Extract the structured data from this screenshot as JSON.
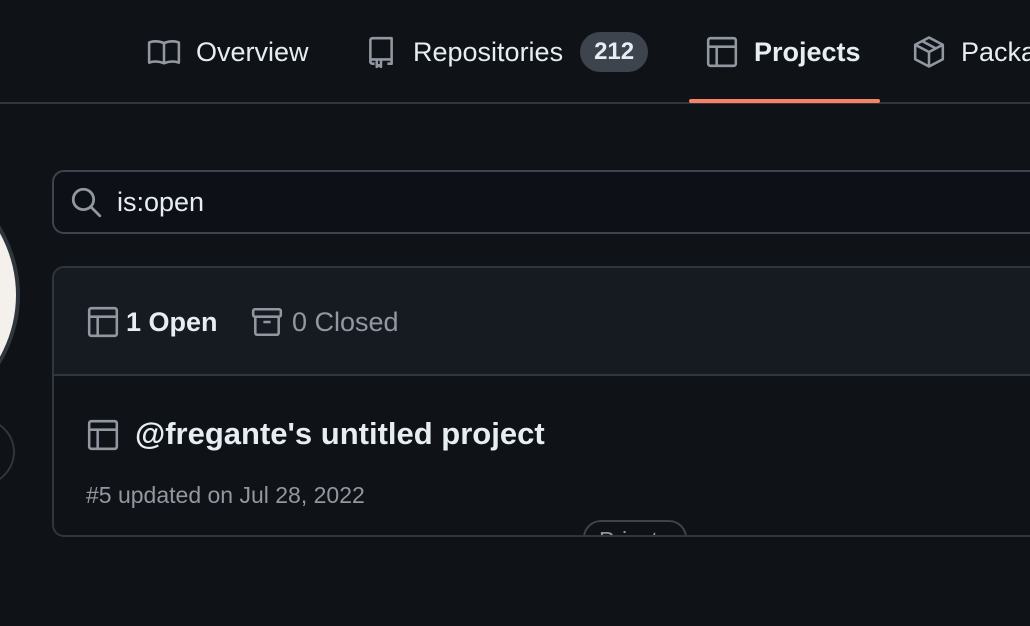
{
  "nav": {
    "tabs": [
      {
        "label": "Overview",
        "icon": "book-icon"
      },
      {
        "label": "Repositories",
        "icon": "repo-icon",
        "count": "212"
      },
      {
        "label": "Projects",
        "icon": "table-icon",
        "active": true
      },
      {
        "label": "Packages",
        "icon": "package-icon"
      }
    ]
  },
  "search": {
    "value": "is:open"
  },
  "filters": {
    "open_label": "1 Open",
    "closed_label": "0 Closed"
  },
  "projects": [
    {
      "title": "@fregante's untitled project",
      "visibility": "Private",
      "meta": "#5 updated on Jul 28, 2022"
    }
  ],
  "colors": {
    "background": "#0f1216",
    "accent_underline": "#f78166",
    "border": "#30363d",
    "muted_text": "#9198a1"
  }
}
